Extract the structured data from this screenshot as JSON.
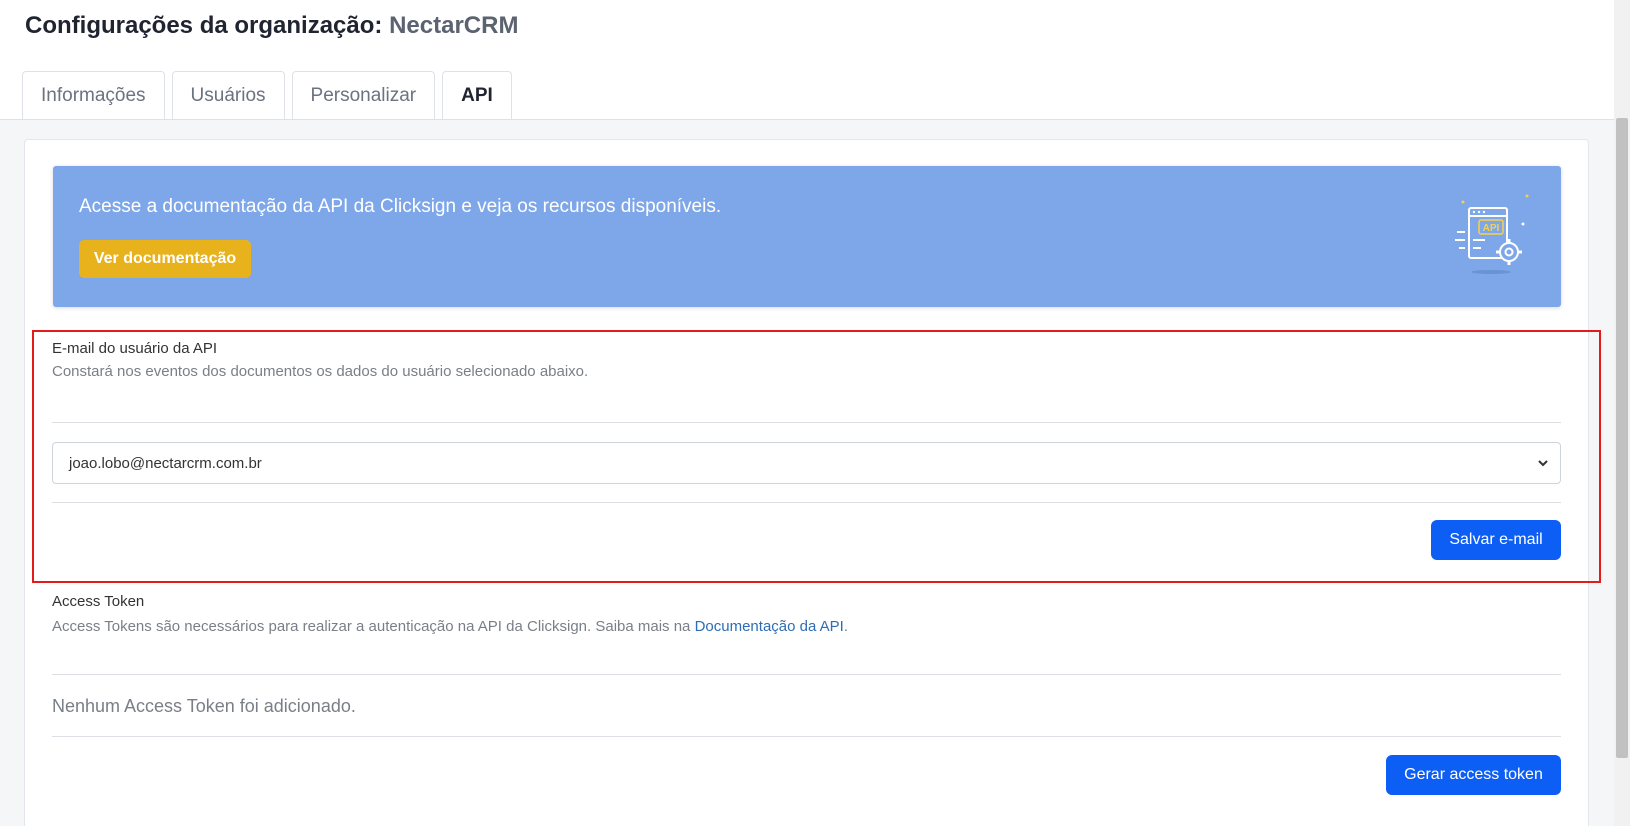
{
  "header": {
    "title_prefix": "Configurações da organização:",
    "org_name": "NectarCRM"
  },
  "tabs": [
    {
      "label": "Informações",
      "active": false
    },
    {
      "label": "Usuários",
      "active": false
    },
    {
      "label": "Personalizar",
      "active": false
    },
    {
      "label": "API",
      "active": true
    }
  ],
  "banner": {
    "text": "Acesse a documentação da API da Clicksign e veja os recursos disponíveis.",
    "button_label": "Ver documentação",
    "illustration_text": "API",
    "color": "#7da7e8",
    "button_color": "#e8b21c"
  },
  "email_section": {
    "label": "E-mail do usuário da API",
    "description": "Constará nos eventos dos documentos os dados do usuário selecionado abaixo.",
    "selected_email": "joao.lobo@nectarcrm.com.br",
    "save_button": "Salvar e-mail"
  },
  "token_section": {
    "label": "Access Token",
    "description": "Access Tokens são necessários para realizar a autenticação na API da Clicksign. Saiba mais na",
    "link_text": "Documentação da API",
    "description_end": ".",
    "empty_message": "Nenhum Access Token foi adicionado.",
    "generate_button": "Gerar access token"
  },
  "colors": {
    "primary": "#0d5ef5",
    "highlight": "#e41b1b",
    "link": "#2f6db5"
  }
}
